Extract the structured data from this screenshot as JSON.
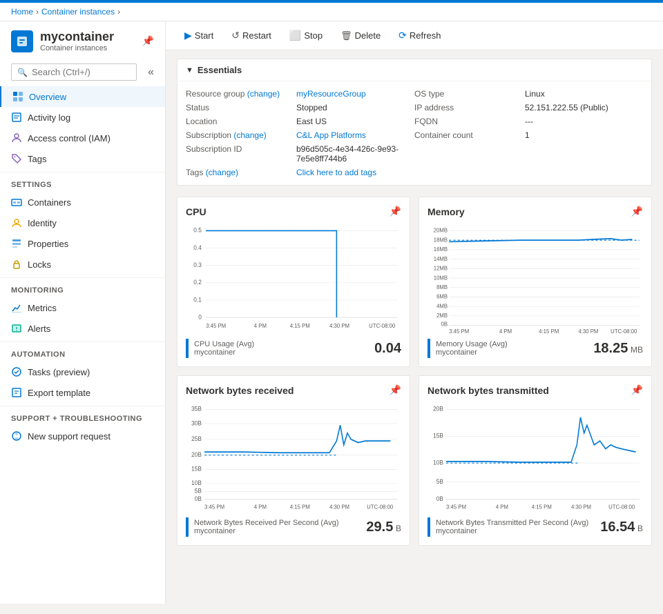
{
  "breadcrumb": {
    "items": [
      "Home",
      "Container instances"
    ],
    "current": ""
  },
  "sidebar": {
    "title": "mycontainer",
    "subtitle": "Container instances",
    "search_placeholder": "Search (Ctrl+/)",
    "collapse_label": "«",
    "nav": [
      {
        "id": "overview",
        "label": "Overview",
        "icon": "overview",
        "active": true
      },
      {
        "id": "activity-log",
        "label": "Activity log",
        "icon": "activity",
        "active": false
      },
      {
        "id": "access-control",
        "label": "Access control (IAM)",
        "icon": "access",
        "active": false
      },
      {
        "id": "tags",
        "label": "Tags",
        "icon": "tags",
        "active": false
      }
    ],
    "sections": [
      {
        "title": "Settings",
        "items": [
          {
            "id": "containers",
            "label": "Containers",
            "icon": "containers"
          },
          {
            "id": "identity",
            "label": "Identity",
            "icon": "identity"
          },
          {
            "id": "properties",
            "label": "Properties",
            "icon": "properties"
          },
          {
            "id": "locks",
            "label": "Locks",
            "icon": "locks"
          }
        ]
      },
      {
        "title": "Monitoring",
        "items": [
          {
            "id": "metrics",
            "label": "Metrics",
            "icon": "metrics"
          },
          {
            "id": "alerts",
            "label": "Alerts",
            "icon": "alerts"
          }
        ]
      },
      {
        "title": "Automation",
        "items": [
          {
            "id": "tasks",
            "label": "Tasks (preview)",
            "icon": "tasks"
          },
          {
            "id": "export",
            "label": "Export template",
            "icon": "export"
          }
        ]
      },
      {
        "title": "Support + troubleshooting",
        "items": [
          {
            "id": "support",
            "label": "New support request",
            "icon": "support"
          }
        ]
      }
    ]
  },
  "toolbar": {
    "buttons": [
      {
        "id": "start",
        "label": "Start",
        "icon": "▶"
      },
      {
        "id": "restart",
        "label": "Restart",
        "icon": "↺"
      },
      {
        "id": "stop",
        "label": "Stop",
        "icon": "■"
      },
      {
        "id": "delete",
        "label": "Delete",
        "icon": "🗑"
      },
      {
        "id": "refresh",
        "label": "Refresh",
        "icon": "⟳"
      }
    ]
  },
  "essentials": {
    "header": "Essentials",
    "left": [
      {
        "label": "Resource group (change)",
        "label_link": true,
        "value": "myResourceGroup",
        "value_link": true
      },
      {
        "label": "Status",
        "value": "Stopped"
      },
      {
        "label": "Location",
        "value": "East US"
      },
      {
        "label": "Subscription (change)",
        "label_link": true,
        "value": "C&L App Platforms",
        "value_link": true
      },
      {
        "label": "Subscription ID",
        "value": "b96d505c-4e34-426c-9e93-7e5e8ff744b6"
      },
      {
        "label": "Tags (change)",
        "label_link": true,
        "value": "Click here to add tags",
        "value_link": true
      }
    ],
    "right": [
      {
        "label": "OS type",
        "value": "Linux"
      },
      {
        "label": "IP address",
        "value": "52.151.222.55 (Public)"
      },
      {
        "label": "FQDN",
        "value": "---"
      },
      {
        "label": "Container count",
        "value": "1"
      }
    ]
  },
  "charts": [
    {
      "id": "cpu",
      "title": "CPU",
      "legend_label": "CPU Usage (Avg)",
      "legend_sublabel": "mycontainer",
      "value": "0.04",
      "unit": "",
      "x_labels": [
        "3:45 PM",
        "4 PM",
        "4:15 PM",
        "4:30 PM",
        "UTC-08:00"
      ],
      "y_labels": [
        "0.5",
        "0.4",
        "0.3",
        "0.2",
        "0.1",
        "0"
      ],
      "type": "cpu"
    },
    {
      "id": "memory",
      "title": "Memory",
      "legend_label": "Memory Usage (Avg)",
      "legend_sublabel": "mycontainer",
      "value": "18.25",
      "unit": "MB",
      "x_labels": [
        "3:45 PM",
        "4 PM",
        "4:15 PM",
        "4:30 PM",
        "UTC-08:00"
      ],
      "y_labels": [
        "20MB",
        "18MB",
        "16MB",
        "14MB",
        "12MB",
        "10MB",
        "8MB",
        "6MB",
        "4MB",
        "2MB",
        "0B"
      ],
      "type": "memory"
    },
    {
      "id": "net-received",
      "title": "Network bytes received",
      "legend_label": "Network Bytes Received Per Second (Avg)",
      "legend_sublabel": "mycontainer",
      "value": "29.5",
      "unit": "B",
      "x_labels": [
        "3:45 PM",
        "4 PM",
        "4:15 PM",
        "4:30 PM",
        "UTC-08:00"
      ],
      "y_labels": [
        "35B",
        "30B",
        "25B",
        "20B",
        "15B",
        "10B",
        "5B",
        "0B"
      ],
      "type": "net-received"
    },
    {
      "id": "net-transmitted",
      "title": "Network bytes transmitted",
      "legend_label": "Network Bytes Transmitted Per Second (Avg)",
      "legend_sublabel": "mycontainer",
      "value": "16.54",
      "unit": "B",
      "x_labels": [
        "3:45 PM",
        "4 PM",
        "4:15 PM",
        "4:30 PM",
        "UTC-08:00"
      ],
      "y_labels": [
        "20B",
        "15B",
        "10B",
        "5B",
        "0B"
      ],
      "type": "net-transmitted"
    }
  ]
}
